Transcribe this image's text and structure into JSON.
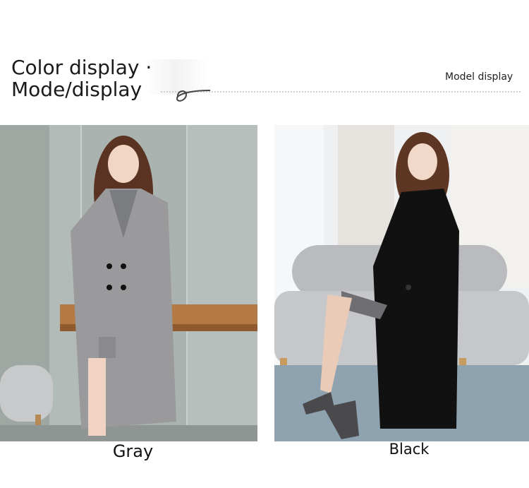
{
  "header": {
    "title_line1": "Color display ·",
    "title_line2": "Mode/display",
    "model_label": "Model display"
  },
  "products": [
    {
      "caption": "Gray"
    },
    {
      "caption": "Black"
    }
  ],
  "colors": {
    "gray_coat": "#9a9a9c",
    "black_coat": "#111111"
  }
}
